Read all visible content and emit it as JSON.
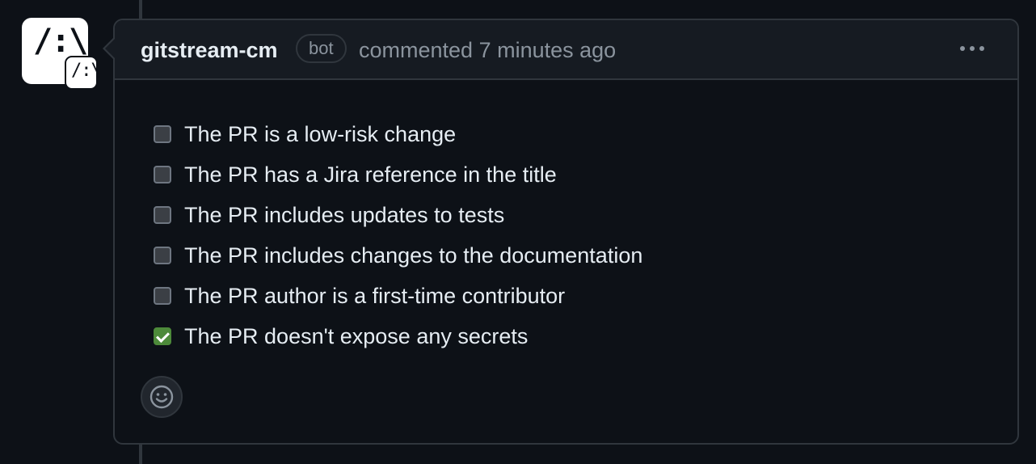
{
  "comment": {
    "author": "gitstream-cm",
    "badge": "bot",
    "action_text": "commented 7 minutes ago",
    "avatar_mark": "/:\\",
    "avatar_badge_mark": "/:\\"
  },
  "tasks": [
    {
      "label": "The PR is a low-risk change",
      "checked": false
    },
    {
      "label": "The PR has a Jira reference in the title",
      "checked": false
    },
    {
      "label": "The PR includes updates to tests",
      "checked": false
    },
    {
      "label": "The PR includes changes to the documentation",
      "checked": false
    },
    {
      "label": "The PR author is a first-time contributor",
      "checked": false
    },
    {
      "label": "The PR doesn't expose any secrets",
      "checked": true
    }
  ],
  "icons": {
    "menu": "kebab-menu-icon",
    "reaction": "smiley-icon"
  },
  "colors": {
    "background": "#0d1117",
    "header_bg": "#161b22",
    "border": "#30363d",
    "checked": "#4d8a3a",
    "muted_text": "#8b949e"
  }
}
